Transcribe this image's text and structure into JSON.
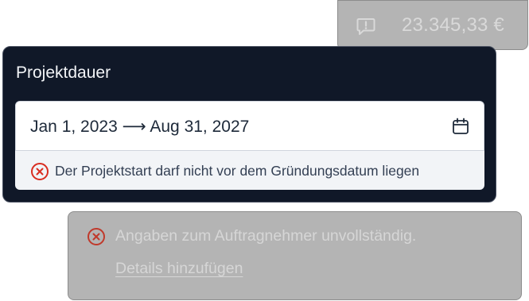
{
  "amount_chip": {
    "icon": "message-alert-icon",
    "amount": "23.345,33 €"
  },
  "duration_card": {
    "title": "Projektdauer",
    "date_range": "Jan 1, 2023 ⟶ Aug 31, 2027",
    "calendar_icon": "calendar-icon",
    "error": {
      "icon": "x-circle-icon",
      "message": "Der Projektstart darf nicht vor dem Gründungsdatum liegen"
    }
  },
  "notice": {
    "icon": "x-circle-icon",
    "message": "Angaben zum Auftragnehmer unvollständig.",
    "link_label": "Details hinzufügen"
  },
  "colors": {
    "error_red": "#d92d20",
    "card_bg": "#101828",
    "disabled_bg": "#b4b4b4"
  }
}
